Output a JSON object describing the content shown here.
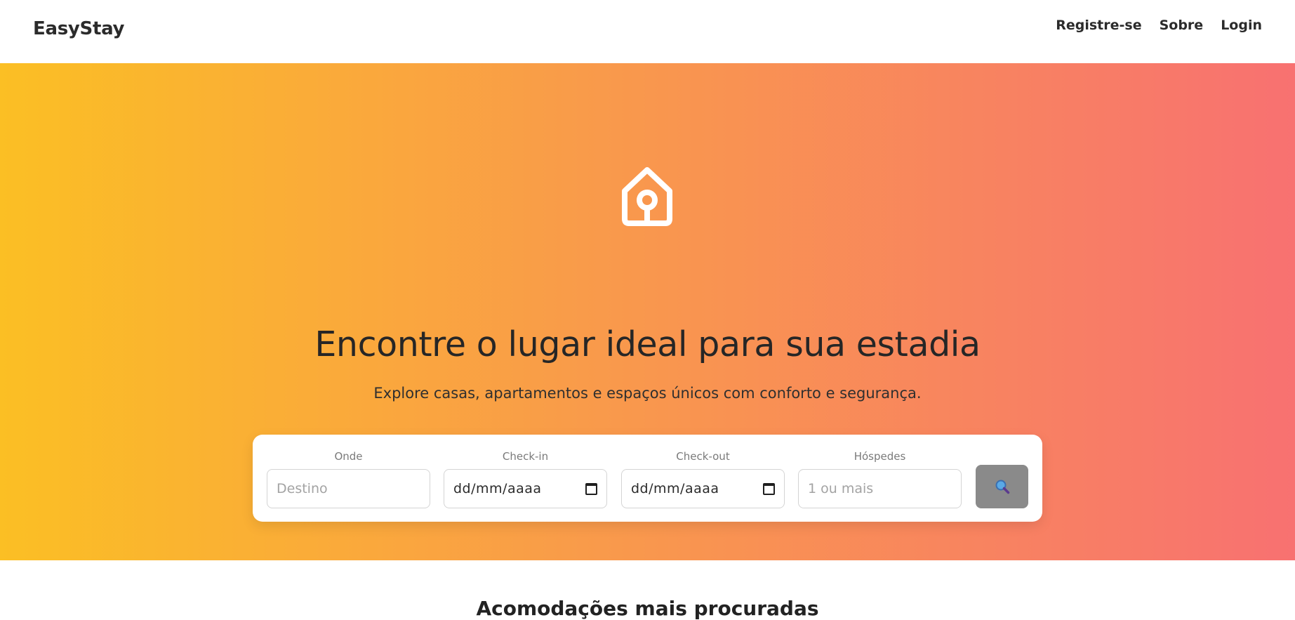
{
  "header": {
    "brand": "EasyStay",
    "nav": {
      "register": "Registre-se",
      "about": "Sobre",
      "login": "Login"
    }
  },
  "hero": {
    "icon": "house-location-icon",
    "title": "Encontre o lugar ideal para sua estadia",
    "subtitle": "Explore casas, apartamentos e espaços únicos com conforto e segurança.",
    "gradient": [
      "#fbbf24",
      "#f99b4a",
      "#f87171"
    ]
  },
  "search": {
    "where": {
      "label": "Onde",
      "placeholder": "Destino",
      "value": ""
    },
    "checkin": {
      "label": "Check-in",
      "value": "dd/mm/aaaa"
    },
    "checkout": {
      "label": "Check-out",
      "value": "dd/mm/aaaa"
    },
    "guests": {
      "label": "Hóspedes",
      "placeholder": "1 ou mais",
      "value": ""
    },
    "button_icon": "magnifier-icon",
    "button_color": "#8a8a8a"
  },
  "section": {
    "title": "Acomodações mais procuradas"
  }
}
